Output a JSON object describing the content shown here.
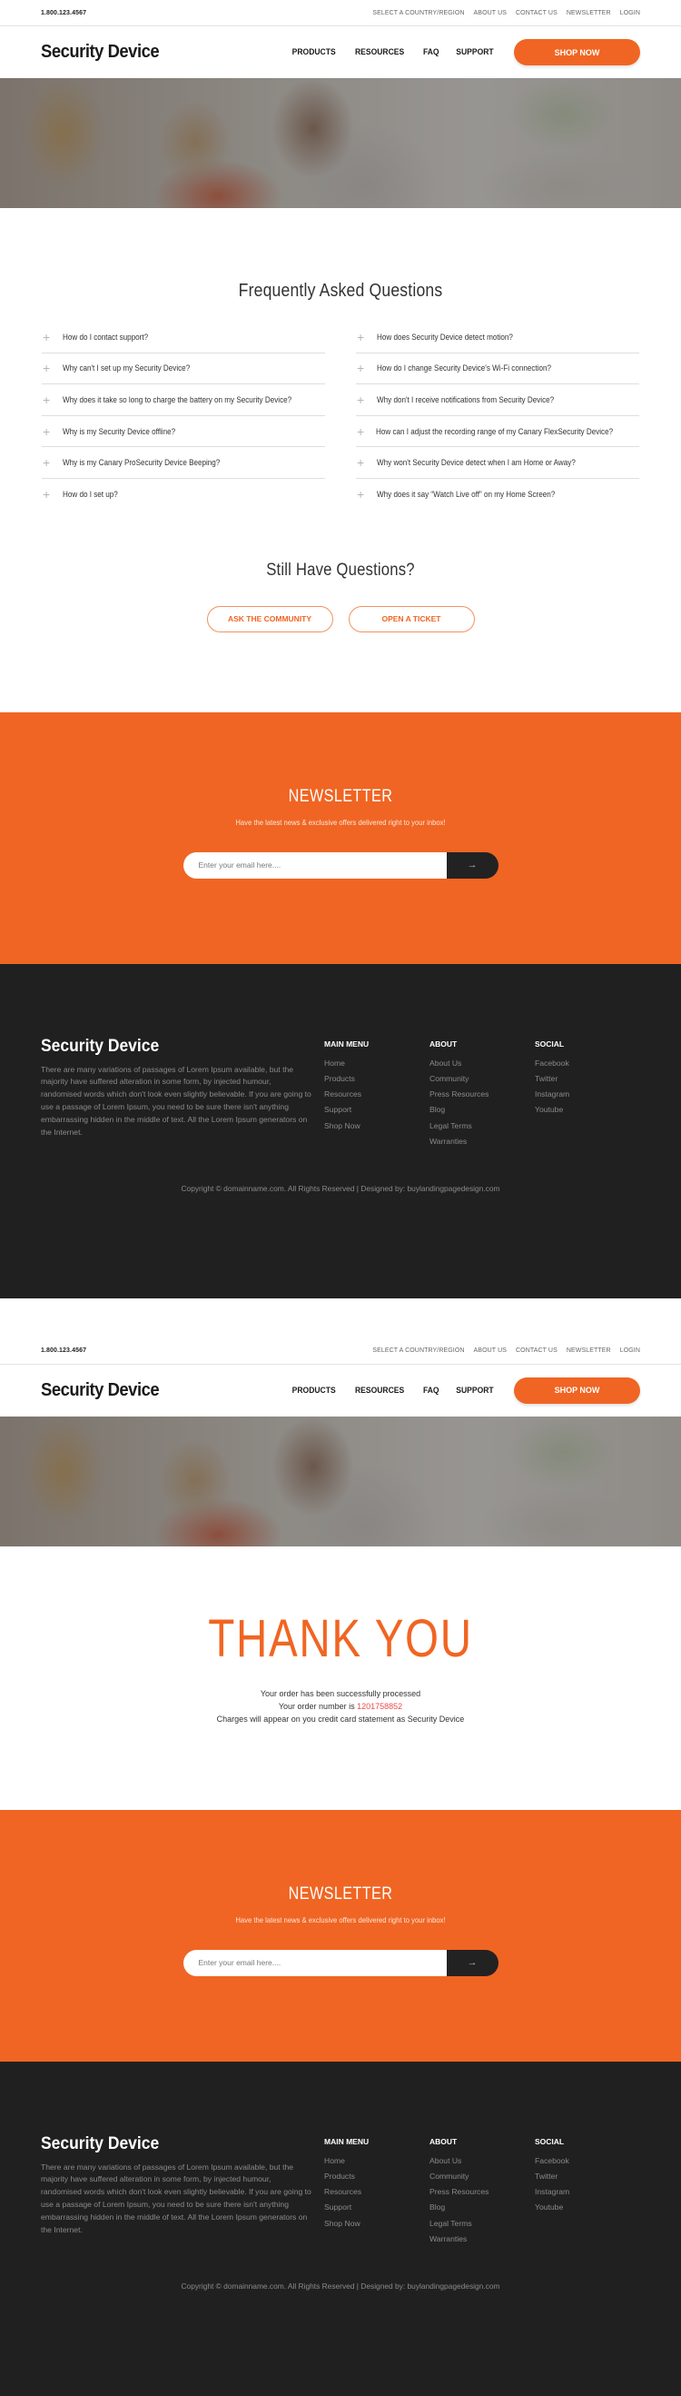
{
  "topbar": {
    "phone": "1.800.123.4567",
    "links": [
      "SELECT A COUNTRY/REGION",
      "ABOUT US",
      "CONTACT US",
      "NEWSLETTER",
      "LOGIN"
    ]
  },
  "header": {
    "logo": "Security Device",
    "nav": [
      "PRODUCTS",
      "RESOURCES",
      "FAQ",
      "SUPPORT"
    ],
    "cta": "SHOP NOW"
  },
  "colors": {
    "accent": "#f06523",
    "dark": "#202020",
    "order_number": "#ef4a4a"
  },
  "faq": {
    "title": "Frequently Asked Questions",
    "icon": "plus-icon",
    "left": [
      "How do I contact support?",
      "Why can't I set up my Security Device?",
      "Why does it take so long to charge the battery on my Security Device?",
      "Why is my Security Device offline?",
      "Why is my Canary ProSecurity Device Beeping?",
      "How do I set up?"
    ],
    "right": [
      "How does Security Device detect motion?",
      "How do I change Security Device's Wi-Fi connection?",
      "Why don't I receive notifications from Security Device?",
      "How can I adjust the recording range of my Canary FlexSecurity Device?",
      "Why won't Security Device detect when I am Home or Away?",
      "Why does it say “Watch Live off” on my Home Screen?"
    ]
  },
  "still": {
    "title": "Still Have Questions?",
    "buttons": [
      "ASK THE COMMUNITY",
      "OPEN A TICKET"
    ]
  },
  "newsletter": {
    "title": "NEWSLETTER",
    "subtitle": "Have the latest news & exclusive offers delivered right to your inbox!",
    "placeholder": "Enter your email here....",
    "submit_icon": "arrow-right-icon",
    "submit_glyph": "→"
  },
  "footer": {
    "logo": "Security Device",
    "description": "There are many variations of passages of Lorem Ipsum available, but the majority have suffered alteration in some form, by injected humour, randomised words which don't look even slightly believable. If you are going to use a passage of Lorem Ipsum, you need to be sure there isn't anything embarrassing hidden in the middle of text. All the Lorem Ipsum generators on the Internet.",
    "columns": [
      {
        "title": "MAIN MENU",
        "links": [
          "Home",
          "Products",
          "Resources",
          "Support",
          "Shop Now"
        ]
      },
      {
        "title": "ABOUT",
        "links": [
          "About Us",
          "Community",
          "Press Resources",
          "Blog",
          "Legal Terms",
          "Warranties"
        ]
      },
      {
        "title": "SOCIAL",
        "links": [
          "Facebook",
          "Twitter",
          "Instagram",
          "Youtube"
        ]
      }
    ],
    "copyright": "Copyright © domainname.com. All Rights Reserved  |  Designed by: buylandingpagedesign.com"
  },
  "thankyou": {
    "title": "THANK YOU",
    "line1": "Your order has been successfully processed",
    "line2_prefix": "Your order number is ",
    "order_number": "1201758852",
    "line3": "Charges will appear on you credit card statement as Security Device"
  }
}
